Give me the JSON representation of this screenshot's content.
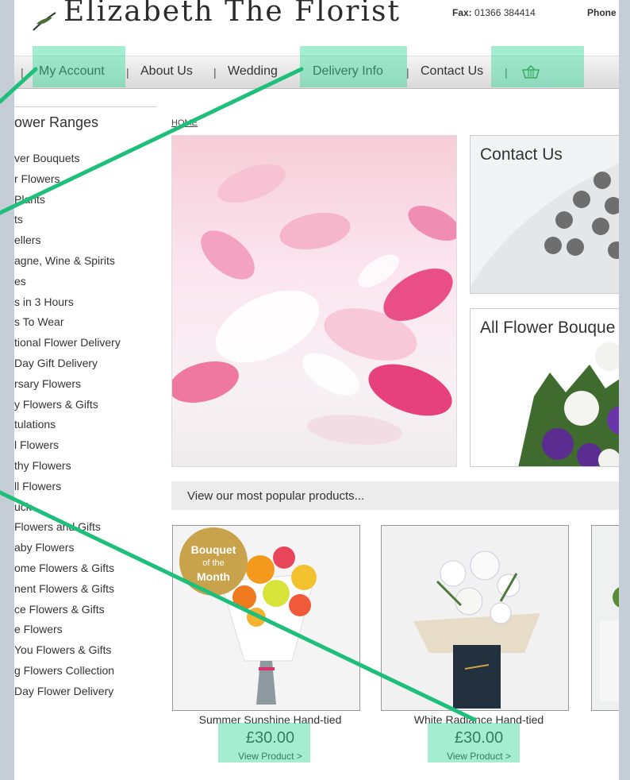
{
  "header": {
    "site_title": "Elizabeth The Florist",
    "fax_label": "Fax:",
    "fax_number": "01366 384414",
    "phone_label": "Phone"
  },
  "nav": {
    "items": [
      {
        "label": "My Account"
      },
      {
        "label": "About Us"
      },
      {
        "label": "Wedding"
      },
      {
        "label": "Delivery Info"
      },
      {
        "label": "Contact Us"
      }
    ],
    "separator": "|",
    "basket_icon": "basket-icon"
  },
  "sidebar": {
    "heading": "ower Ranges",
    "items": [
      "ver Bouquets",
      "r Flowers",
      "Plants",
      "ts",
      "ellers",
      "agne, Wine & Spirits",
      "es",
      "s in 3 Hours",
      "s To Wear",
      "tional Flower Delivery",
      "Day Gift Delivery",
      "rsary Flowers",
      "y Flowers & Gifts",
      "tulations",
      "l Flowers",
      "thy Flowers",
      "ll Flowers",
      "uck",
      "Flowers and Gifts",
      "aby Flowers",
      "ome Flowers & Gifts",
      "nent Flowers & Gifts",
      "ce Flowers & Gifts",
      "e Flowers",
      "You Flowers & Gifts",
      "g Flowers Collection",
      "Day Flower Delivery"
    ]
  },
  "main": {
    "breadcrumb": "HOME",
    "panels": [
      {
        "title": "Contact Us"
      },
      {
        "title": "All Flower Bouque"
      }
    ],
    "popular_label": "View our most popular products...",
    "products": [
      {
        "name": "Summer Sunshine Hand-tied",
        "price": "£30.00",
        "link": "View Product >",
        "badge": [
          "Bouquet",
          "of the",
          "Month"
        ]
      },
      {
        "name": "White Radiance Hand-tied",
        "price": "£30.00",
        "link": "View Product >"
      }
    ]
  },
  "colors": {
    "highlight": "#38d696",
    "annotation_line": "#1dbf7a",
    "nav_bg": "#dcdcdc",
    "badge": "#c9a24c"
  }
}
